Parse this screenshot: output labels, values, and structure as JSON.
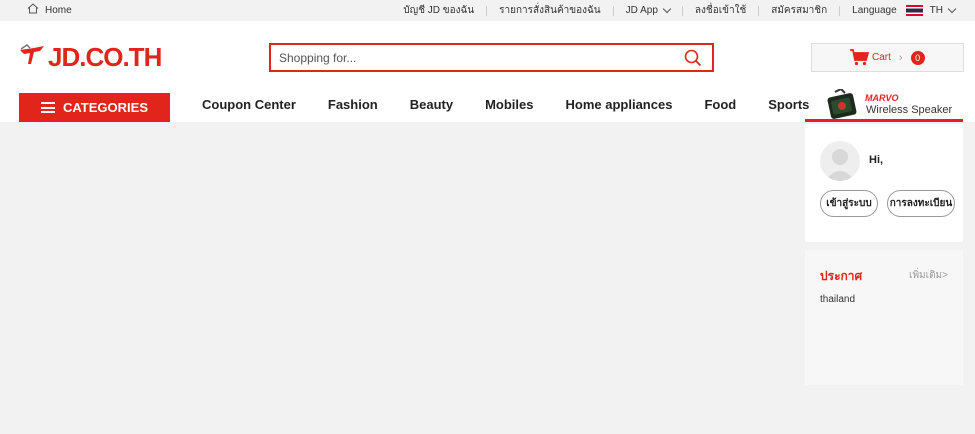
{
  "topbar": {
    "home_label": "Home",
    "links": [
      "บัญชี JD ของฉัน",
      "รายการสั่งสินค้าของฉัน",
      "JD App",
      "ลงชื่อเข้าใช้",
      "สมัครสมาชิก",
      "Language"
    ],
    "lang_code": "TH"
  },
  "header": {
    "logo_text": "JD.CO.TH",
    "search_placeholder": "Shopping for...",
    "cart_label": "Cart",
    "cart_count": "0"
  },
  "nav": {
    "categories_label": "CATEGORIES",
    "items": [
      "Coupon Center",
      "Fashion",
      "Beauty",
      "Mobiles",
      "Home appliances",
      "Food",
      "Sports"
    ],
    "promo_brand": "MARVO",
    "promo_title": "Wireless Speaker"
  },
  "user_panel": {
    "greeting": "Hi,",
    "login_label": "เข้าสู่ระบบ",
    "register_label": "การลงทะเบียน",
    "announcement_title": "ประกาศ",
    "announcement_more": "เพิ่มเติม>",
    "announcement_item": "thailand"
  },
  "colors": {
    "brand_red": "#e1251b",
    "background": "#f2f2f2"
  }
}
